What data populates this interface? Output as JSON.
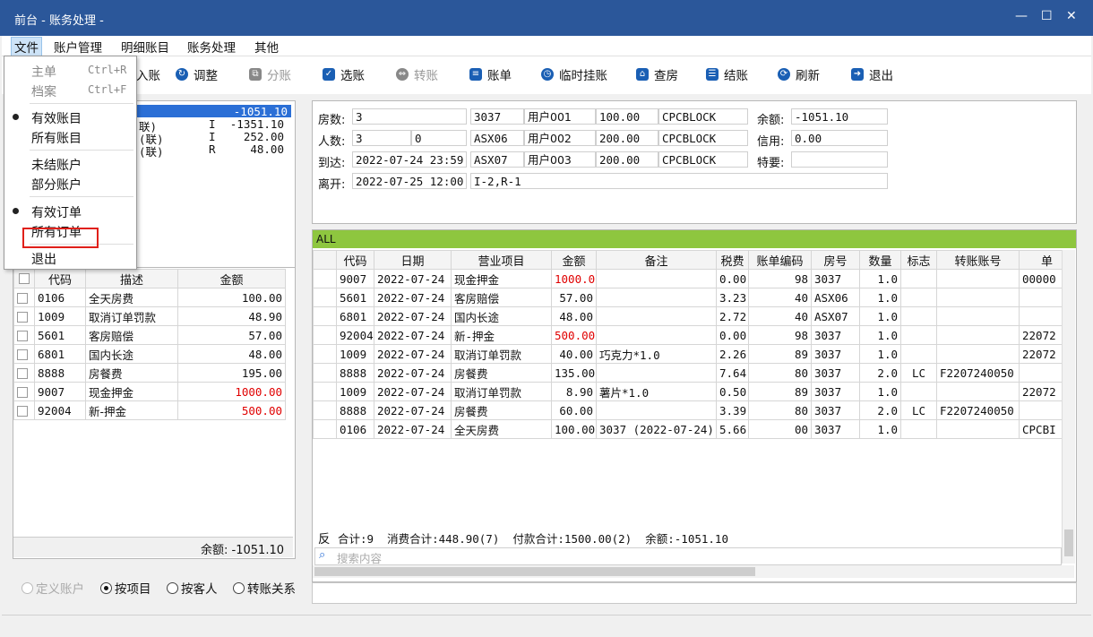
{
  "window": {
    "title": "前台 - 账务处理 -",
    "controls": [
      "—",
      "☐",
      "✕"
    ]
  },
  "menubar": [
    "文件",
    "账户管理",
    "明细账目",
    "账务处理",
    "其他"
  ],
  "toolbar": [
    {
      "label": "入账",
      "icon": "plus-icon"
    },
    {
      "label": "调整",
      "icon": "adjust-icon"
    },
    {
      "label": "分账",
      "icon": "split-icon",
      "disabled": true
    },
    {
      "label": "选账",
      "icon": "select-icon"
    },
    {
      "label": "转账",
      "icon": "transfer-icon",
      "disabled": true
    },
    {
      "label": "账单",
      "icon": "bill-icon"
    },
    {
      "label": "临时挂账",
      "icon": "clock-icon"
    },
    {
      "label": "查房",
      "icon": "house-icon"
    },
    {
      "label": "结账",
      "icon": "database-icon"
    },
    {
      "label": "刷新",
      "icon": "refresh-icon"
    },
    {
      "label": "退出",
      "icon": "exit-icon"
    }
  ],
  "file_menu": {
    "items": [
      {
        "label": "主单",
        "shortcut": "Ctrl+R",
        "disabled": true
      },
      {
        "label": "档案",
        "shortcut": "Ctrl+F",
        "disabled": true
      },
      {
        "label": "有效账目",
        "checked": true
      },
      {
        "label": "所有账目"
      },
      {
        "label": "未结账户"
      },
      {
        "label": "部分账户",
        "highlighted": true
      },
      {
        "label": "有效订单",
        "checked": true
      },
      {
        "label": "所有订单"
      },
      {
        "label": "退出"
      }
    ]
  },
  "accounts": {
    "lines": [
      {
        "name": "",
        "type": "",
        "amount": "-1051.10",
        "selected": true
      },
      {
        "name": "联)",
        "type": "I",
        "amount": "-1351.10"
      },
      {
        "name": "(联)",
        "type": "I",
        "amount": "252.00"
      },
      {
        "name": "(联)",
        "type": "R",
        "amount": "48.00"
      }
    ]
  },
  "left_grid": {
    "headers": [
      "代码",
      "描述",
      "金额"
    ],
    "rows": [
      {
        "code": "0106",
        "desc": "全天房费",
        "amount": "100.00"
      },
      {
        "code": "1009",
        "desc": "取消订单罚款",
        "amount": "48.90"
      },
      {
        "code": "5601",
        "desc": "客房赔偿",
        "amount": "57.00"
      },
      {
        "code": "6801",
        "desc": "国内长途",
        "amount": "48.00"
      },
      {
        "code": "8888",
        "desc": "房餐费",
        "amount": "195.00"
      },
      {
        "code": "9007",
        "desc": "现金押金",
        "amount": "1000.00",
        "red": true
      },
      {
        "code": "92004",
        "desc": "新-押金",
        "amount": "500.00",
        "red": true
      }
    ],
    "balance": "余额: -1051.10"
  },
  "view_options": {
    "options": [
      "定义账户",
      "按项目",
      "按客人",
      "转账关系"
    ],
    "selected": "按项目"
  },
  "info": {
    "rooms_label": "房数:",
    "rooms": "3",
    "persons_label": "人数:",
    "persons": "3",
    "persons2": "0",
    "arrive_label": "到达:",
    "arrive": "2022-07-24 23:59",
    "depart_label": "离开:",
    "depart": "2022-07-25 12:00",
    "room_code": "I-2,R-1",
    "subaccounts": [
      {
        "room": "3037",
        "user": "用户001",
        "amount": "100.00",
        "code": "CPCBLOCK"
      },
      {
        "room": "ASX06",
        "user": "用户002",
        "amount": "200.00",
        "code": "CPCBLOCK"
      },
      {
        "room": "ASX07",
        "user": "用户003",
        "amount": "200.00",
        "code": "CPCBLOCK"
      }
    ],
    "balance_label": "余额:",
    "balance": "-1051.10",
    "credit_label": "信用:",
    "credit": "0.00",
    "special_label": "特要:",
    "special": ""
  },
  "detail": {
    "group": "ALL",
    "headers": [
      "代码",
      "日期",
      "营业项目",
      "金额",
      "备注",
      "税费",
      "账单编码",
      "房号",
      "数量",
      "标志",
      "转账账号",
      "单"
    ],
    "rows": [
      [
        "9007",
        "2022-07-24",
        "现金押金",
        "1000.00",
        "",
        "0.00",
        "98",
        "3037",
        "1.0",
        "",
        "",
        "00000"
      ],
      [
        "5601",
        "2022-07-24",
        "客房赔偿",
        "57.00",
        "",
        "3.23",
        "40",
        "ASX06",
        "1.0",
        "",
        "",
        ""
      ],
      [
        "6801",
        "2022-07-24",
        "国内长途",
        "48.00",
        "",
        "2.72",
        "40",
        "ASX07",
        "1.0",
        "",
        "",
        ""
      ],
      [
        "92004",
        "2022-07-24",
        "新-押金",
        "500.00",
        "",
        "0.00",
        "98",
        "3037",
        "1.0",
        "",
        "",
        "22072"
      ],
      [
        "1009",
        "2022-07-24",
        "取消订单罚款",
        "40.00",
        "巧克力*1.0",
        "2.26",
        "89",
        "3037",
        "1.0",
        "",
        "",
        "22072"
      ],
      [
        "8888",
        "2022-07-24",
        "房餐费",
        "135.00",
        "",
        "7.64",
        "80",
        "3037",
        "2.0",
        "LC",
        "F2207240050",
        ""
      ],
      [
        "1009",
        "2022-07-24",
        "取消订单罚款",
        "8.90",
        "薯片*1.0",
        "0.50",
        "89",
        "3037",
        "1.0",
        "",
        "",
        "22072"
      ],
      [
        "8888",
        "2022-07-24",
        "房餐费",
        "60.00",
        "",
        "3.39",
        "80",
        "3037",
        "2.0",
        "LC",
        "F2207240050",
        ""
      ],
      [
        "0106",
        "2022-07-24",
        "全天房费",
        "100.00",
        "3037 (2022-07-24)",
        "5.66",
        "00",
        "3037",
        "1.0",
        "",
        "",
        "CPCBI"
      ]
    ],
    "red_rows": [
      0,
      3
    ],
    "reverse_label": "反",
    "summary": "合计:9  消费合计:448.90(7)  付款合计:1500.00(2)  余额:-1051.10",
    "search_placeholder": "搜索内容"
  }
}
